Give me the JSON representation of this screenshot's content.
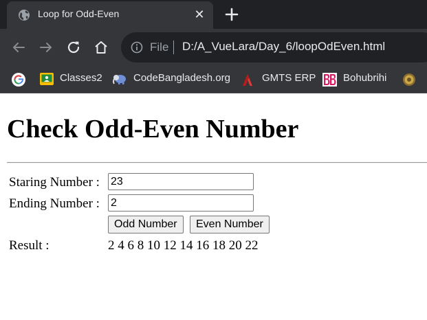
{
  "browser": {
    "tab": {
      "title": "Loop for Odd-Even",
      "close_glyph": "✕"
    },
    "toolbar": {
      "address_label": "File",
      "url": "D:/A_VueLara/Day_6/loopOdEven.html"
    },
    "bookmarks": [
      {
        "label": "",
        "icon": "google-icon"
      },
      {
        "label": "Classes2",
        "icon": "classroom-icon"
      },
      {
        "label": "CodeBangladesh.org",
        "icon": "elephant-icon"
      },
      {
        "label": "GMTS ERP",
        "icon": "red-a-icon"
      },
      {
        "label": "Bohubrihi",
        "icon": "bb-logo-icon"
      },
      {
        "label": "",
        "icon": "emblem-icon"
      }
    ],
    "colors": {
      "tabstrip": "#202124",
      "toolbar": "#35363a",
      "text": "#e8eaed"
    }
  },
  "page": {
    "heading": "Check Odd-Even Number",
    "start_label": "Staring Number :",
    "start_value": "23",
    "end_label": "Ending Number :",
    "end_value": "2",
    "odd_button": "Odd Number",
    "even_button": "Even Number",
    "result_label": "Result :",
    "result_value": "2 4 6 8 10 12 14 16 18 20 22"
  }
}
